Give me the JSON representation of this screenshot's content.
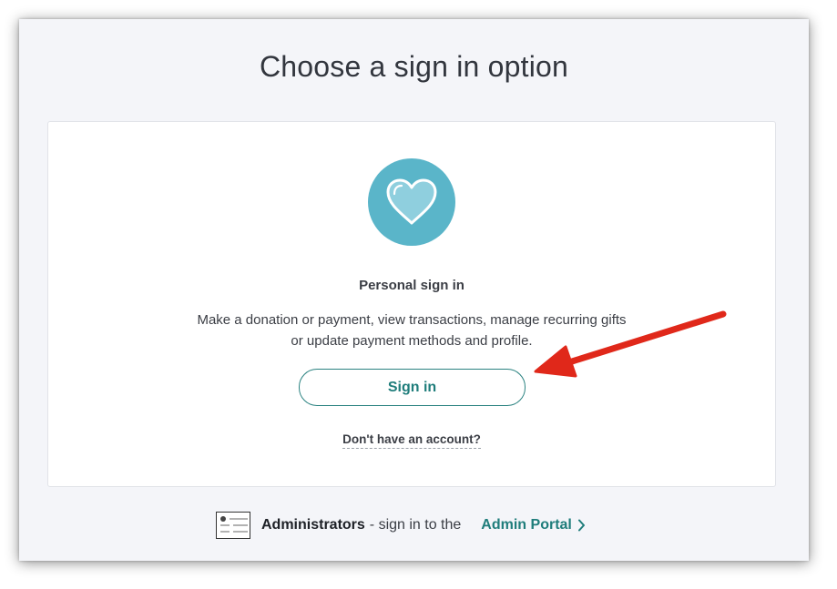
{
  "page": {
    "title": "Choose a sign in option"
  },
  "personal": {
    "heading": "Personal sign in",
    "description_line1": "Make a donation or payment, view transactions, manage recurring gifts",
    "description_line2": "or update payment methods and profile.",
    "signin_label": "Sign in",
    "no_account_label": "Don't have an account?",
    "icon": "heart-icon"
  },
  "admin": {
    "bold_label": "Administrators",
    "middle_text": "- sign in to the",
    "link_label": "Admin Portal",
    "icon": "admin-portal-icon",
    "link_icon": "chevron-right-icon"
  },
  "colors": {
    "accent": "#1f7d7b",
    "heart_circle": "#5ab5c9",
    "annotation_arrow": "#e0281a"
  }
}
